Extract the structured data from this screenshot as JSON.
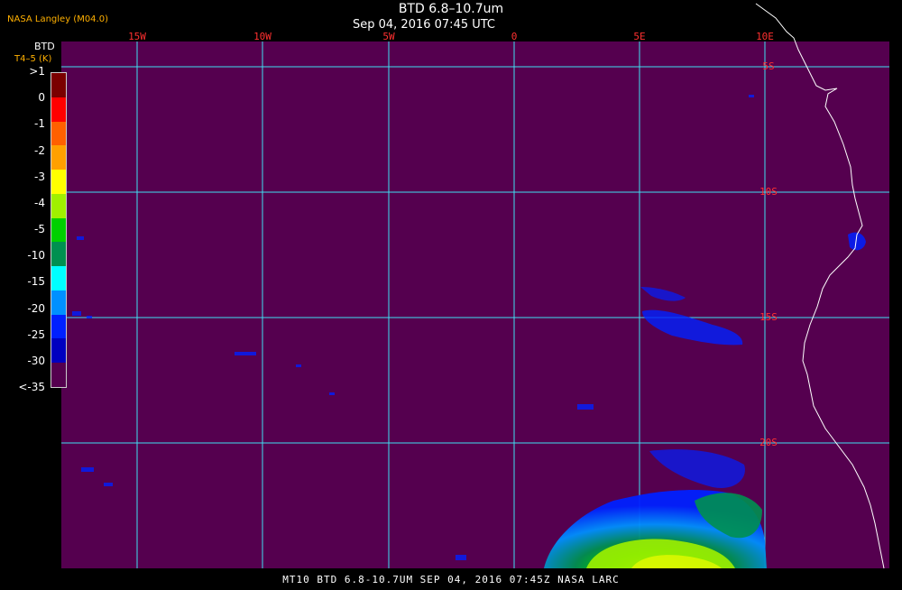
{
  "header": {
    "producer": "NASA Langley (M04.0)",
    "title": "BTD 6.8–10.7um",
    "subtitle": "Sep 04, 2016 07:45 UTC"
  },
  "legend": {
    "title": "BTD",
    "unit": "T4–5 (K)",
    "labels": [
      ">1",
      "0",
      "-1",
      "-2",
      "-3",
      "-4",
      "-5",
      "-10",
      "-15",
      "-20",
      "-25",
      "-30",
      "<-35"
    ],
    "colors": [
      "#7a0000",
      "#ff0000",
      "#ff6000",
      "#ffa000",
      "#ffff00",
      "#a0f000",
      "#00d000",
      "#009050",
      "#00ffff",
      "#0090ff",
      "#0020ff",
      "#0000c0",
      "#55004f"
    ]
  },
  "map": {
    "background_color": "#55004f",
    "grid_color": "#40e0f0",
    "coast_color": "#ffffff",
    "longitude_labels": [
      "15W",
      "10W",
      "5W",
      "0",
      "5E",
      "10E"
    ],
    "latitude_labels": [
      "5S",
      "10S",
      "15S",
      "20S"
    ]
  },
  "footer": {
    "text": "MT10  BTD 6.8-10.7UM  SEP 04, 2016 07:45Z  NASA LARC"
  }
}
